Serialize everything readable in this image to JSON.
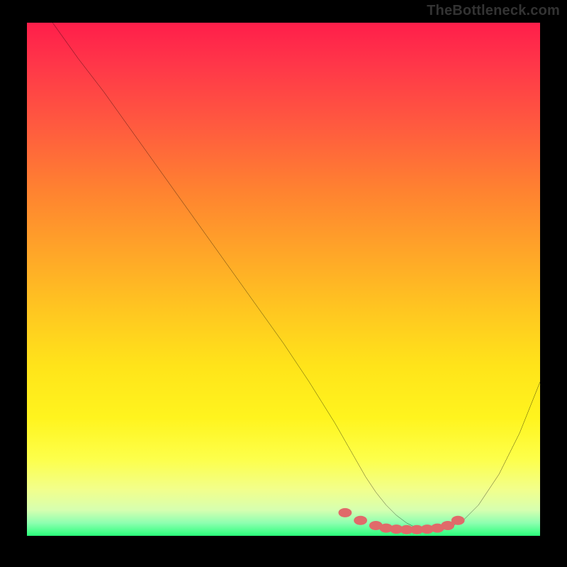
{
  "watermark": "TheBottleneck.com",
  "chart_data": {
    "type": "line",
    "title": "",
    "xlabel": "",
    "ylabel": "",
    "xlim": [
      0,
      100
    ],
    "ylim": [
      0,
      100
    ],
    "series": [
      {
        "name": "curve",
        "color": "#000000",
        "x": [
          5,
          10,
          15,
          20,
          25,
          30,
          35,
          40,
          45,
          50,
          55,
          60,
          62,
          64,
          66,
          68,
          70,
          72,
          74,
          76,
          78,
          80,
          82,
          85,
          88,
          92,
          96,
          100
        ],
        "y": [
          100,
          93,
          86.5,
          79.5,
          72.5,
          65.5,
          58.5,
          51.5,
          44.5,
          37.5,
          30,
          22,
          18.5,
          15,
          11.5,
          8.5,
          6,
          4,
          2.5,
          1.5,
          1,
          1,
          1.5,
          3,
          6,
          12,
          20,
          30
        ]
      }
    ],
    "markers": {
      "name": "highlight-dots",
      "color": "#e06a6a",
      "x": [
        62,
        65,
        68,
        70,
        72,
        74,
        76,
        78,
        80,
        82,
        84
      ],
      "y": [
        4.5,
        3,
        2,
        1.5,
        1.3,
        1.2,
        1.2,
        1.3,
        1.5,
        2,
        3
      ]
    }
  }
}
